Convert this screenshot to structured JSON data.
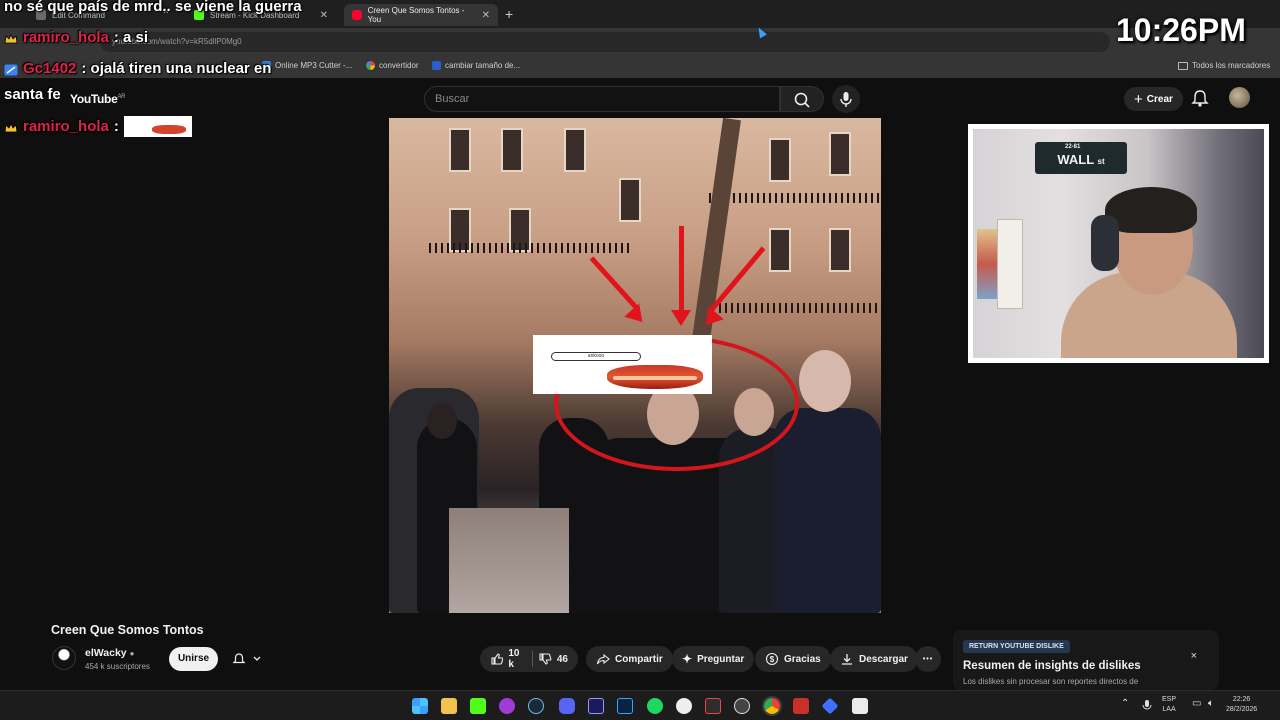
{
  "browser": {
    "tabs": [
      {
        "label": "Edit Command",
        "active": false
      },
      {
        "label": "Stream - Kick Dashboard",
        "active": false
      },
      {
        "label": "Creen Que Somos Tontos - You",
        "active": true
      }
    ],
    "url": "youtube.com/watch?v=kR5dllP0Mg0",
    "bookmarks": [
      "Online MP3 Cutter -...",
      "convertidor",
      "cambiar tamaño de..."
    ],
    "all_bookmarks": "Todos los marcadores"
  },
  "youtube": {
    "logo": "YouTube",
    "region": "AR",
    "search_placeholder": "Buscar",
    "create_label": "Crear"
  },
  "video": {
    "title": "Creen Que Somos Tontos",
    "sticker_text": "ankooo"
  },
  "channel": {
    "name": "elWacky",
    "subscribers": "454 k suscriptores",
    "join_label": "Unirse"
  },
  "actions": {
    "likes": "10 k",
    "dislikes": "46",
    "share": "Compartir",
    "ask": "Preguntar",
    "thanks": "Gracias",
    "download": "Descargar",
    "more": "•••"
  },
  "dislike_panel": {
    "tag": "RETURN YOUTUBE DISLIKE",
    "heading": "Resumen de insights de dislikes",
    "desc": "Los dislikes sin procesar son reportes directos de",
    "close": "×"
  },
  "chat": [
    {
      "user": "",
      "text": "no sé que país de mrd.. se viene la guerra"
    },
    {
      "user": "ramiro_hola",
      "text": ": a si"
    },
    {
      "user": "Gc1402",
      "text": ": ojalá tiren una nuclear en"
    },
    {
      "user": "",
      "text": "santa fe"
    },
    {
      "user": "ramiro_hola",
      "text": ":"
    }
  ],
  "overlay_clock": "10:26PM",
  "webcam": {
    "sign_top": "22-81",
    "sign_main": "WALL",
    "sign_st": "st"
  },
  "taskbar": {
    "lang_top": "ESP",
    "lang_bottom": "LAA",
    "time": "22:26",
    "date": "28/2/2026"
  },
  "colors": {
    "chat_user": "#e0214a",
    "red_ring": "#d1161c",
    "tab_active": "#353535"
  }
}
